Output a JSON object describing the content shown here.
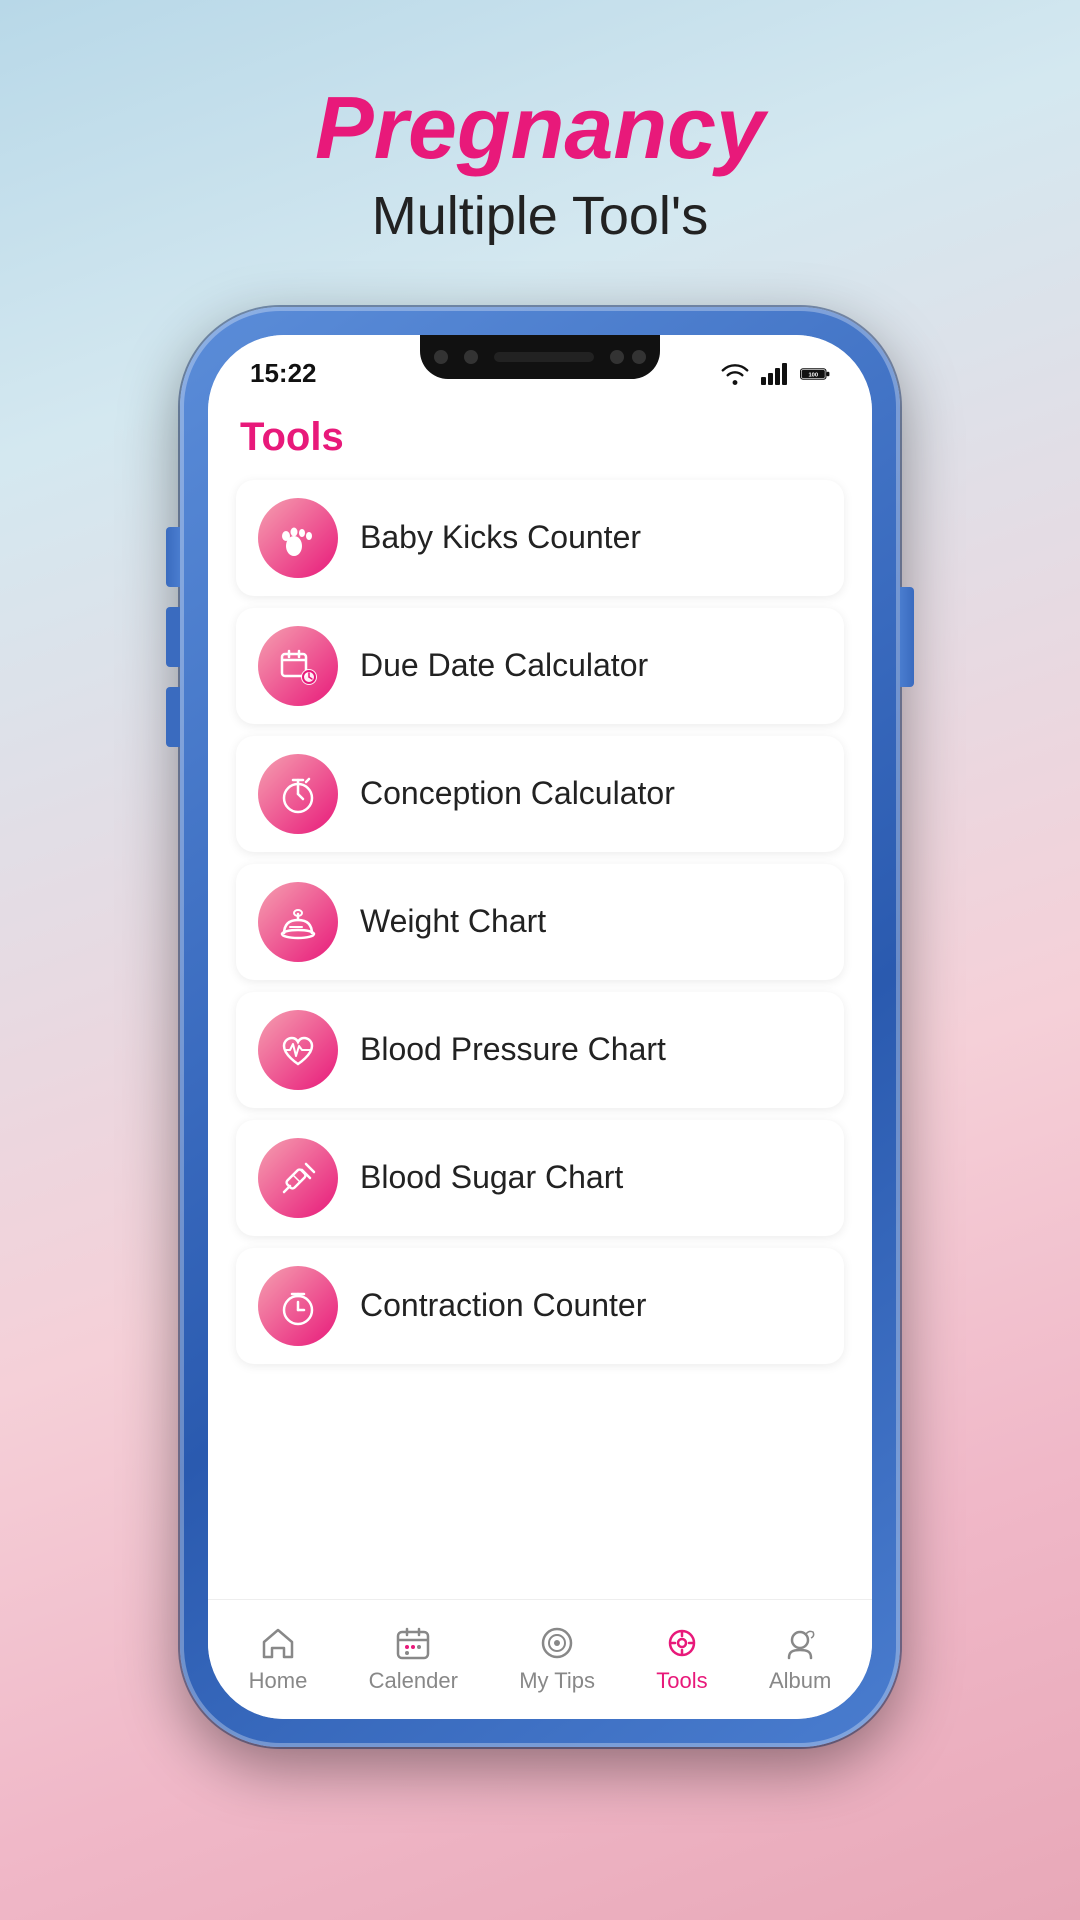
{
  "header": {
    "title": "Pregnancy",
    "subtitle": "Multiple Tool's"
  },
  "phone": {
    "status_time": "15:22",
    "battery": "100"
  },
  "screen": {
    "tools_title": "Tools",
    "menu_items": [
      {
        "id": "baby-kicks",
        "label": "Baby Kicks Counter",
        "icon": "footprint"
      },
      {
        "id": "due-date",
        "label": "Due Date Calculator",
        "icon": "calendar-clock"
      },
      {
        "id": "conception",
        "label": "Conception Calculator",
        "icon": "stopwatch"
      },
      {
        "id": "weight-chart",
        "label": "Weight Chart",
        "icon": "scale"
      },
      {
        "id": "blood-pressure",
        "label": "Blood Pressure Chart",
        "icon": "heartbeat"
      },
      {
        "id": "blood-sugar",
        "label": "Blood Sugar Chart",
        "icon": "syringe"
      },
      {
        "id": "contraction",
        "label": "Contraction Counter",
        "icon": "timer"
      }
    ]
  },
  "bottom_nav": {
    "items": [
      {
        "id": "home",
        "label": "Home",
        "active": false
      },
      {
        "id": "calender",
        "label": "Calender",
        "active": false
      },
      {
        "id": "my-tips",
        "label": "My Tips",
        "active": false
      },
      {
        "id": "tools",
        "label": "Tools",
        "active": true
      },
      {
        "id": "album",
        "label": "Album",
        "active": false
      }
    ]
  }
}
